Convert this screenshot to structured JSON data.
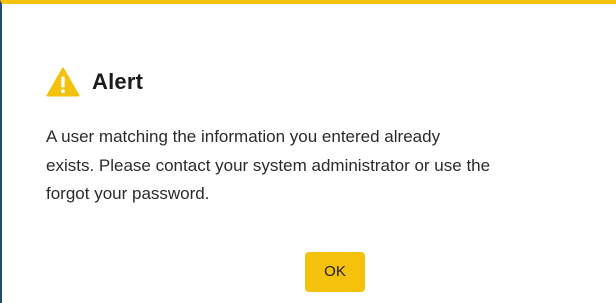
{
  "alert": {
    "icon": "warning-icon",
    "title": "Alert",
    "message_lines": [
      "A user matching the information you entered already",
      "exists. Please contact your system administrator or use the",
      "forgot your password."
    ],
    "ok_label": "OK"
  },
  "colors": {
    "accent": "#f4c20d",
    "frame_border": "#1f4e79"
  }
}
